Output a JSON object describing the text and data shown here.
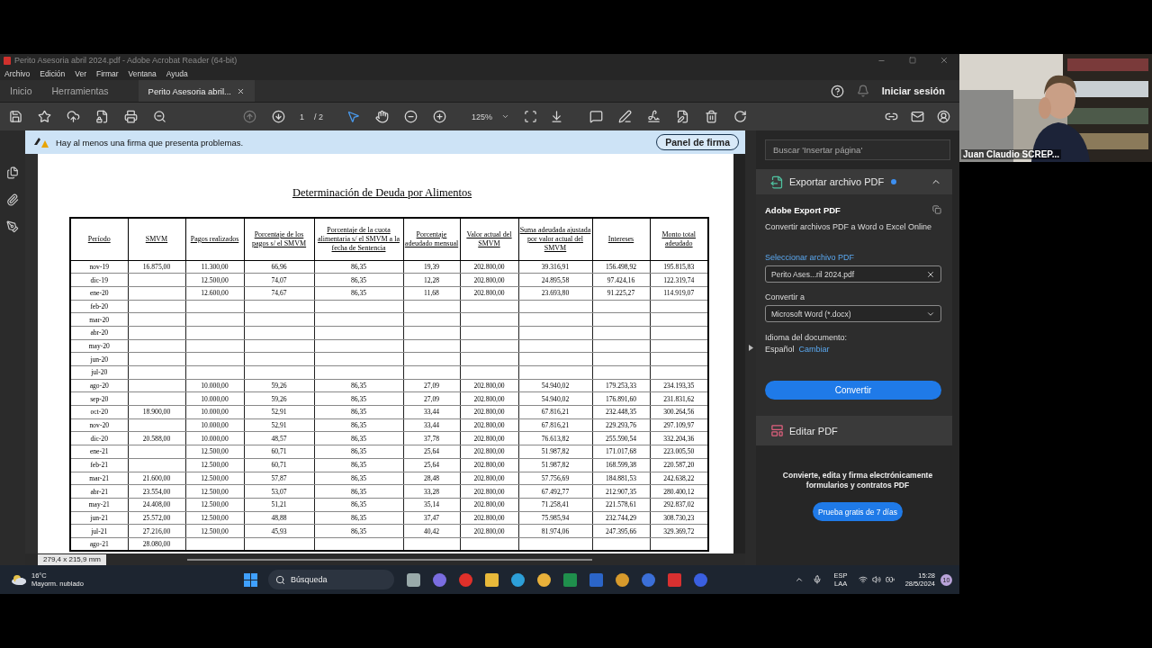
{
  "window": {
    "title": "Perito Asesoria abril 2024.pdf - Adobe Acrobat Reader (64-bit)"
  },
  "menu": [
    "Archivo",
    "Edición",
    "Ver",
    "Firmar",
    "Ventana",
    "Ayuda"
  ],
  "tabs": [
    {
      "label": "Inicio",
      "selected": false
    },
    {
      "label": "Herramientas",
      "selected": false
    },
    {
      "label": "Perito Asesoria abril...",
      "selected": true
    }
  ],
  "account": {
    "label": "Iniciar sesión"
  },
  "toolbar": {
    "page": "1",
    "page_total": "/ 2",
    "zoom": "125%"
  },
  "notice": {
    "text": "Hay al menos una firma que presenta problemas.",
    "button": "Panel de firma"
  },
  "document": {
    "title": "Determinación de Deuda por Alimentos",
    "columns": [
      "Período",
      "SMVM",
      "Pagos realizados",
      "Porcentaje de los pagos s/ el SMVM",
      "Porcentaje de la cuota alimentaria s/ el SMVM a la fecha de Sentencia",
      "Porcentaje adeudado mensual",
      "Valor actual del SMVM",
      "Suma adeudada ajustada por valor actual del SMVM",
      "Intereses",
      "Monto total adeudado"
    ],
    "rows": [
      [
        "nov-19",
        "16.875,00",
        "11.300,00",
        "66,96",
        "86,35",
        "19,39",
        "202.800,00",
        "39.316,91",
        "156.498,92",
        "195.815,83"
      ],
      [
        "dic-19",
        null,
        "12.500,00",
        "74,07",
        "86,35",
        "12,28",
        "202.800,00",
        "24.895,58",
        "97.424,16",
        "122.319,74"
      ],
      [
        "ene-20",
        null,
        "12.600,00",
        "74,67",
        "86,35",
        "11,68",
        "202.800,00",
        "23.693,80",
        "91.225,27",
        "114.919,07"
      ],
      [
        "feb-20",
        null,
        null,
        null,
        null,
        null,
        null,
        null,
        null,
        null
      ],
      [
        "mar-20",
        null,
        null,
        null,
        null,
        null,
        null,
        null,
        null,
        null
      ],
      [
        "abr-20",
        null,
        null,
        null,
        null,
        null,
        null,
        null,
        null,
        null
      ],
      [
        "may-20",
        null,
        null,
        null,
        null,
        null,
        null,
        null,
        null,
        null
      ],
      [
        "jun-20",
        null,
        null,
        null,
        null,
        null,
        null,
        null,
        null,
        null
      ],
      [
        "jul-20",
        null,
        null,
        null,
        null,
        null,
        null,
        null,
        null,
        null
      ],
      [
        "ago-20",
        null,
        "10.000,00",
        "59,26",
        "86,35",
        "27,09",
        "202.800,00",
        "54.940,02",
        "179.253,33",
        "234.193,35"
      ],
      [
        "sep-20",
        null,
        "10.000,00",
        "59,26",
        "86,35",
        "27,09",
        "202.800,00",
        "54.940,02",
        "176.891,60",
        "231.831,62"
      ],
      [
        "oct-20",
        "18.900,00",
        "10.000,00",
        "52,91",
        "86,35",
        "33,44",
        "202.800,00",
        "67.816,21",
        "232.448,35",
        "300.264,56"
      ],
      [
        "nov-20",
        null,
        "10.000,00",
        "52,91",
        "86,35",
        "33,44",
        "202.800,00",
        "67.816,21",
        "229.293,76",
        "297.109,97"
      ],
      [
        "dic-20",
        "20.588,00",
        "10.000,00",
        "48,57",
        "86,35",
        "37,78",
        "202.800,00",
        "76.613,82",
        "255.590,54",
        "332.204,36"
      ],
      [
        "ene-21",
        null,
        "12.500,00",
        "60,71",
        "86,35",
        "25,64",
        "202.800,00",
        "51.987,82",
        "171.017,68",
        "223.005,50"
      ],
      [
        "feb-21",
        null,
        "12.500,00",
        "60,71",
        "86,35",
        "25,64",
        "202.800,00",
        "51.987,82",
        "168.599,38",
        "220.587,20"
      ],
      [
        "mar-21",
        "21.600,00",
        "12.500,00",
        "57,87",
        "86,35",
        "28,48",
        "202.800,00",
        "57.756,69",
        "184.881,53",
        "242.638,22"
      ],
      [
        "abr-21",
        "23.554,00",
        "12.500,00",
        "53,07",
        "86,35",
        "33,28",
        "202.800,00",
        "67.492,77",
        "212.907,35",
        "280.400,12"
      ],
      [
        "may-21",
        "24.408,00",
        "12.500,00",
        "51,21",
        "86,35",
        "35,14",
        "202.800,00",
        "71.258,41",
        "221.578,61",
        "292.837,02"
      ],
      [
        "jun-21",
        "25.572,00",
        "12.500,00",
        "48,88",
        "86,35",
        "37,47",
        "202.800,00",
        "75.985,94",
        "232.744,29",
        "308.730,23"
      ],
      [
        "jul-21",
        "27.216,00",
        "12.500,00",
        "45,93",
        "86,35",
        "40,42",
        "202.800,00",
        "81.974,06",
        "247.395,66",
        "329.369,72"
      ],
      [
        "ago-21",
        "28.080,00",
        null,
        null,
        null,
        null,
        null,
        null,
        null,
        null
      ]
    ]
  },
  "status": {
    "page_size": "279,4 x 215,9 mm"
  },
  "right_panel": {
    "search_placeholder": "Buscar 'Insertar página'",
    "export_section": {
      "title": "Exportar archivo PDF",
      "expanded": true,
      "heading": "Adobe Export PDF",
      "description": "Convertir archivos PDF a Word o Excel Online",
      "file_label": "Seleccionar archivo PDF",
      "file_value": "Perito Ases...ril 2024.pdf",
      "convert_label": "Convertir a",
      "convert_value": "Microsoft Word (*.docx)",
      "language_label": "Idioma del documento:",
      "language": "Español",
      "language_link": "Cambiar",
      "button": "Convertir"
    },
    "edit_section": {
      "title": "Editar PDF"
    },
    "promo": {
      "text": "Convierte, edita y firma electrónicamente formularios y contratos PDF",
      "button": "Prueba gratis de 7 días"
    }
  },
  "video": {
    "name": "Juan Claudio SCREP..."
  },
  "taskbar": {
    "weather_temp": "16°C",
    "weather_text": "Mayorm. nublado",
    "search_label": "Búsqueda",
    "language": "ESP",
    "layout": "LAA",
    "time": "15:28",
    "date": "28/5/2024",
    "badge": "10"
  }
}
